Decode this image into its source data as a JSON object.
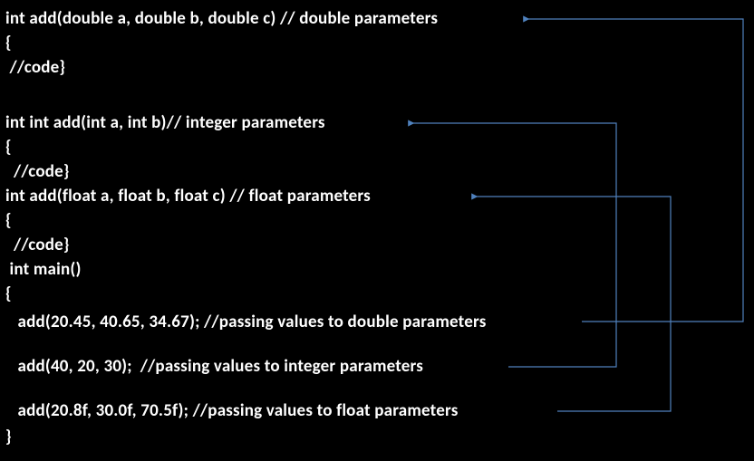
{
  "lines": {
    "l1": "int add(double a, double b, double c) // double parameters",
    "l2": "{",
    "l3": " //code}",
    "l4": "int int add(int a, int b)// integer parameters",
    "l5": "{",
    "l6": "  //code}",
    "l7": "int add(float a, float b, float c) // float parameters",
    "l8": "{",
    "l9": "  //code}",
    "l10": " int main()",
    "l11": "{",
    "l12": "   add(20.45, 40.65, 34.67); //passing values to double parameters",
    "l13": "   add(40, 20, 30);  //passing values to integer parameters",
    "l14": "   add(20.8f, 30.0f, 70.5f); //passing values to float parameters",
    "l15": "}"
  },
  "arrows": {
    "c1": "connects call add(20.45,40.65,34.67) to double declaration",
    "c2": "connects call add(40,20,30) to integer declaration",
    "c3": "connects call add(20.8f,30.0f,70.5f) to float declaration"
  },
  "colors": {
    "arrow": "#4f81bd",
    "text": "#ffffff",
    "bg": "#000000"
  }
}
